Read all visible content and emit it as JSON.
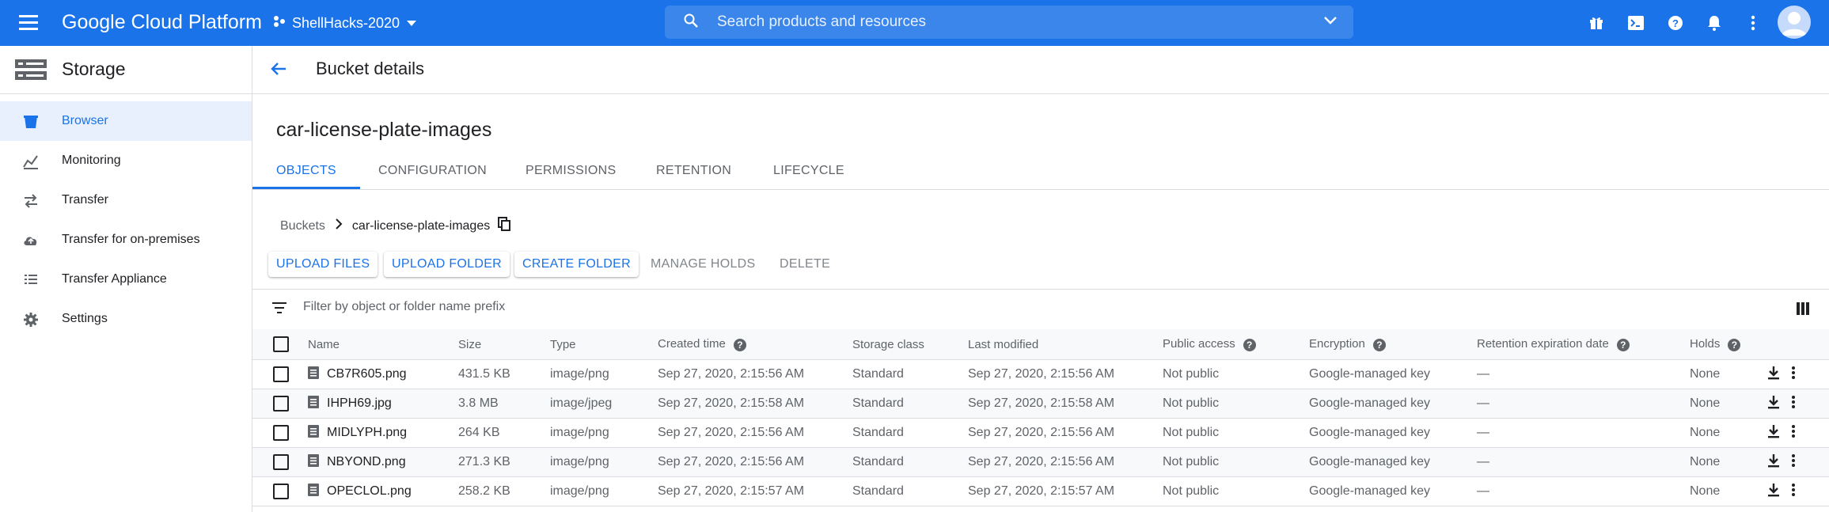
{
  "topbar": {
    "brand": "Google Cloud Platform",
    "project": "ShellHacks-2020",
    "search_placeholder": "Search products and resources",
    "icons": [
      "menu-icon",
      "project-icon",
      "search-icon",
      "chevron-down-icon",
      "gift-icon",
      "cloud-shell-icon",
      "help-icon",
      "notifications-icon",
      "more-vert-icon",
      "account-avatar"
    ]
  },
  "sidebar": {
    "title": "Storage",
    "items": [
      {
        "label": "Browser",
        "icon": "bucket-icon",
        "active": true
      },
      {
        "label": "Monitoring",
        "icon": "monitoring-icon"
      },
      {
        "label": "Transfer",
        "icon": "transfer-icon"
      },
      {
        "label": "Transfer for on-premises",
        "icon": "cloud-upload-icon"
      },
      {
        "label": "Transfer Appliance",
        "icon": "appliance-icon"
      },
      {
        "label": "Settings",
        "icon": "gear-icon"
      }
    ]
  },
  "page": {
    "title": "Bucket details",
    "bucket_name": "car-license-plate-images",
    "tabs": [
      "OBJECTS",
      "CONFIGURATION",
      "PERMISSIONS",
      "RETENTION",
      "LIFECYCLE"
    ],
    "active_tab": "OBJECTS",
    "breadcrumb": [
      "Buckets",
      "car-license-plate-images"
    ],
    "actions": {
      "upload_files": "UPLOAD FILES",
      "upload_folder": "UPLOAD FOLDER",
      "create_folder": "CREATE FOLDER",
      "manage_holds": "MANAGE HOLDS",
      "delete": "DELETE"
    },
    "filter_placeholder": "Filter by object or folder name prefix"
  },
  "table": {
    "columns": [
      "Name",
      "Size",
      "Type",
      "Created time",
      "Storage class",
      "Last modified",
      "Public access",
      "Encryption",
      "Retention expiration date",
      "Holds"
    ],
    "rows": [
      {
        "name": "CB7R605.png",
        "size": "431.5 KB",
        "type": "image/png",
        "created": "Sep 27, 2020, 2:15:56 AM",
        "storage_class": "Standard",
        "modified": "Sep 27, 2020, 2:15:56 AM",
        "public_access": "Not public",
        "encryption": "Google-managed key",
        "retention": "—",
        "holds": "None"
      },
      {
        "name": "IHPH69.jpg",
        "size": "3.8 MB",
        "type": "image/jpeg",
        "created": "Sep 27, 2020, 2:15:58 AM",
        "storage_class": "Standard",
        "modified": "Sep 27, 2020, 2:15:58 AM",
        "public_access": "Not public",
        "encryption": "Google-managed key",
        "retention": "—",
        "holds": "None"
      },
      {
        "name": "MIDLYPH.png",
        "size": "264 KB",
        "type": "image/png",
        "created": "Sep 27, 2020, 2:15:56 AM",
        "storage_class": "Standard",
        "modified": "Sep 27, 2020, 2:15:56 AM",
        "public_access": "Not public",
        "encryption": "Google-managed key",
        "retention": "—",
        "holds": "None"
      },
      {
        "name": "NBYOND.png",
        "size": "271.3 KB",
        "type": "image/png",
        "created": "Sep 27, 2020, 2:15:56 AM",
        "storage_class": "Standard",
        "modified": "Sep 27, 2020, 2:15:56 AM",
        "public_access": "Not public",
        "encryption": "Google-managed key",
        "retention": "—",
        "holds": "None"
      },
      {
        "name": "OPECLOL.png",
        "size": "258.2 KB",
        "type": "image/png",
        "created": "Sep 27, 2020, 2:15:57 AM",
        "storage_class": "Standard",
        "modified": "Sep 27, 2020, 2:15:57 AM",
        "public_access": "Not public",
        "encryption": "Google-managed key",
        "retention": "—",
        "holds": "None"
      }
    ]
  },
  "colors": {
    "accent": "#1a73e8",
    "active_bg": "#e8f0fe",
    "text": "#202124",
    "muted": "#5f6368"
  }
}
